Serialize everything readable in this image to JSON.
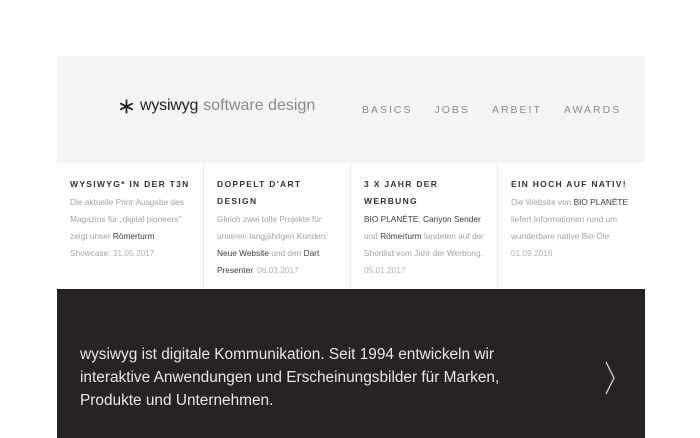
{
  "header": {
    "logo_name": "wysiwyg",
    "logo_tagline": "software design",
    "nav": [
      "BASICS",
      "JOBS",
      "ARBEIT",
      "AWARDS"
    ]
  },
  "cards": [
    {
      "title": "wysiwyg* in der t3n",
      "body": [
        {
          "t": "Die aktuelle Print-Ausgabe des Magazins für „digital pioneers\" zeigt unser ",
          "k": "text"
        },
        {
          "t": "Römerturm",
          "k": "link"
        },
        {
          "t": " Showcase. ",
          "k": "text"
        },
        {
          "t": "31.05.2017",
          "k": "date"
        }
      ]
    },
    {
      "title": "Doppelt d'Art Design",
      "body": [
        {
          "t": "Gleich zwei tolle Projekte für unseren langjährigen Kunden: ",
          "k": "text"
        },
        {
          "t": "Neue Website",
          "k": "link"
        },
        {
          "t": " und den ",
          "k": "text"
        },
        {
          "t": "Dart Presenter",
          "k": "link"
        },
        {
          "t": ". ",
          "k": "text"
        },
        {
          "t": "06.03.2017",
          "k": "date"
        }
      ]
    },
    {
      "title": "3 x Jahr der Werbung",
      "body": [
        {
          "t": "BIO PLANÈTE",
          "k": "link"
        },
        {
          "t": ", ",
          "k": "text"
        },
        {
          "t": "Canyon Sender",
          "k": "link"
        },
        {
          "t": " und ",
          "k": "text"
        },
        {
          "t": "Römerturm",
          "k": "link"
        },
        {
          "t": " landeten auf der Shortlist vom Jahr der Werbung. ",
          "k": "text"
        },
        {
          "t": "05.01.2017",
          "k": "date"
        }
      ]
    },
    {
      "title": "Ein Hoch auf Nativ!",
      "body": [
        {
          "t": "Die Website von ",
          "k": "text"
        },
        {
          "t": "BIO PLANÈTE",
          "k": "link"
        },
        {
          "t": " liefert Informationen rund um wunderbare native Bio-Öle. ",
          "k": "text"
        },
        {
          "t": "01.09.2016",
          "k": "date"
        }
      ]
    }
  ],
  "hero": {
    "text": "wysiwyg ist digitale Kommunikation. Seit 1994 entwickeln wir interaktive Anwendungen und Erscheinungsbilder für Marken, Produkte und Unternehmen."
  },
  "colors": {
    "header_bg": "#f5f5f5",
    "hero_bg": "#272324",
    "link_text": "#3c3c3c",
    "muted_text": "#a3a3a3"
  }
}
